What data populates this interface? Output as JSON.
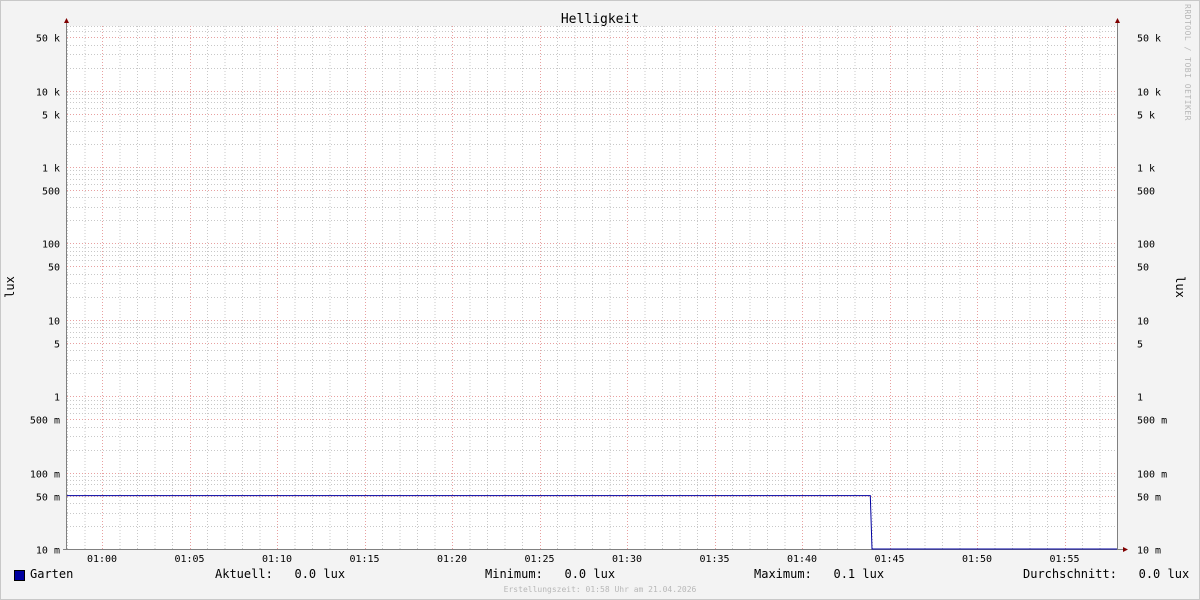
{
  "chart_data": {
    "type": "line",
    "title": "Helligkeit",
    "ylabel": "lux",
    "yscale": "log",
    "ylim": [
      0.01,
      70000
    ],
    "y_ticks": [
      {
        "value": 50000,
        "label": "50 k"
      },
      {
        "value": 10000,
        "label": "10 k"
      },
      {
        "value": 5000,
        "label": "5 k"
      },
      {
        "value": 1000,
        "label": "1 k"
      },
      {
        "value": 500,
        "label": "500"
      },
      {
        "value": 100,
        "label": "100"
      },
      {
        "value": 50,
        "label": "50"
      },
      {
        "value": 10,
        "label": "10"
      },
      {
        "value": 5,
        "label": "5"
      },
      {
        "value": 1,
        "label": "1"
      },
      {
        "value": 0.5,
        "label": "500 m"
      },
      {
        "value": 0.1,
        "label": "100 m"
      },
      {
        "value": 0.05,
        "label": "50 m"
      },
      {
        "value": 0.01,
        "label": "10 m"
      }
    ],
    "x_range_minutes": [
      -2,
      58
    ],
    "x_ticks": [
      {
        "value": 0,
        "label": "01:00"
      },
      {
        "value": 5,
        "label": "01:05"
      },
      {
        "value": 10,
        "label": "01:10"
      },
      {
        "value": 15,
        "label": "01:15"
      },
      {
        "value": 20,
        "label": "01:20"
      },
      {
        "value": 25,
        "label": "01:25"
      },
      {
        "value": 30,
        "label": "01:30"
      },
      {
        "value": 35,
        "label": "01:35"
      },
      {
        "value": 40,
        "label": "01:40"
      },
      {
        "value": 45,
        "label": "01:45"
      },
      {
        "value": 50,
        "label": "01:50"
      },
      {
        "value": 55,
        "label": "01:55"
      }
    ],
    "series": [
      {
        "name": "Garten",
        "color": "#0000a0",
        "points": [
          {
            "x": -2,
            "y": 0.05
          },
          {
            "x": 43.9,
            "y": 0.05
          },
          {
            "x": 44.0,
            "y": 0.01
          },
          {
            "x": 58,
            "y": 0.01
          }
        ]
      }
    ],
    "grid": true,
    "colors": {
      "major_grid": "#e8a0a0",
      "minor_grid": "#c8c8c8",
      "axis": "#808080",
      "arrow": "#800000"
    }
  },
  "legend": {
    "series_label": "Garten",
    "current": "Aktuell:   0.0 lux",
    "minimum": "Minimum:   0.0 lux",
    "maximum": "Maximum:   0.1 lux",
    "average": "Durchschnitt:   0.0 lux"
  },
  "footer": "Erstellungszeit: 01:58 Uhr am 21.04.2026",
  "watermark": "RRDTOOL / TOBI OETIKER"
}
